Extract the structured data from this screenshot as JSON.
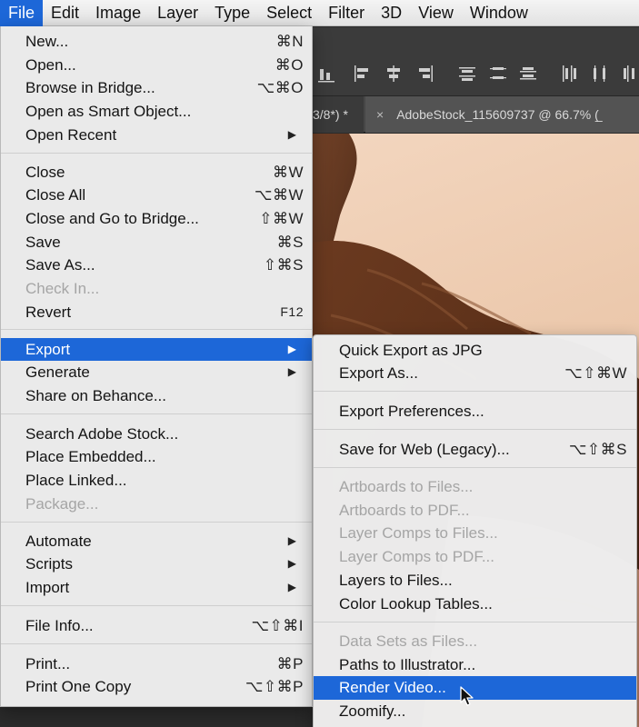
{
  "menubar": {
    "items": [
      "File",
      "Edit",
      "Image",
      "Layer",
      "Type",
      "Select",
      "Filter",
      "3D",
      "View",
      "Window"
    ]
  },
  "tabs": {
    "previous": "3/8*) *",
    "active_close": "×",
    "active": "AdobeStock_115609737 @ 66.7% (̲"
  },
  "file_menu": {
    "new": {
      "label": "New...",
      "shortcut": "⌘N"
    },
    "open": {
      "label": "Open...",
      "shortcut": "⌘O"
    },
    "browse_bridge": {
      "label": "Browse in Bridge...",
      "shortcut": "⌥⌘O"
    },
    "open_smart_object": {
      "label": "Open as Smart Object..."
    },
    "open_recent": {
      "label": "Open Recent",
      "arrow": "▶"
    },
    "close": {
      "label": "Close",
      "shortcut": "⌘W"
    },
    "close_all": {
      "label": "Close All",
      "shortcut": "⌥⌘W"
    },
    "close_go_bridge": {
      "label": "Close and Go to Bridge...",
      "shortcut": "⇧⌘W"
    },
    "save": {
      "label": "Save",
      "shortcut": "⌘S"
    },
    "save_as": {
      "label": "Save As...",
      "shortcut": "⇧⌘S"
    },
    "check_in": {
      "label": "Check In..."
    },
    "revert": {
      "label": "Revert",
      "shortcut": "F12"
    },
    "export": {
      "label": "Export",
      "arrow": "▶"
    },
    "generate": {
      "label": "Generate",
      "arrow": "▶"
    },
    "share_behance": {
      "label": "Share on Behance..."
    },
    "search_stock": {
      "label": "Search Adobe Stock..."
    },
    "place_embedded": {
      "label": "Place Embedded..."
    },
    "place_linked": {
      "label": "Place Linked..."
    },
    "package": {
      "label": "Package..."
    },
    "automate": {
      "label": "Automate",
      "arrow": "▶"
    },
    "scripts": {
      "label": "Scripts",
      "arrow": "▶"
    },
    "import": {
      "label": "Import",
      "arrow": "▶"
    },
    "file_info": {
      "label": "File Info...",
      "shortcut": "⌥⇧⌘I"
    },
    "print": {
      "label": "Print...",
      "shortcut": "⌘P"
    },
    "print_one_copy": {
      "label": "Print One Copy",
      "shortcut": "⌥⇧⌘P"
    }
  },
  "export_menu": {
    "quick_export_jpg": {
      "label": "Quick Export as JPG"
    },
    "export_as": {
      "label": "Export As...",
      "shortcut": "⌥⇧⌘W"
    },
    "export_preferences": {
      "label": "Export Preferences..."
    },
    "save_for_web": {
      "label": "Save for Web (Legacy)...",
      "shortcut": "⌥⇧⌘S"
    },
    "artboards_files": {
      "label": "Artboards to Files..."
    },
    "artboards_pdf": {
      "label": "Artboards to PDF..."
    },
    "layer_comps_files": {
      "label": "Layer Comps to Files..."
    },
    "layer_comps_pdf": {
      "label": "Layer Comps to PDF..."
    },
    "layers_to_files": {
      "label": "Layers to Files..."
    },
    "color_lookup": {
      "label": "Color Lookup Tables..."
    },
    "data_sets": {
      "label": "Data Sets as Files..."
    },
    "paths_illustrator": {
      "label": "Paths to Illustrator..."
    },
    "render_video": {
      "label": "Render Video..."
    },
    "zoomify": {
      "label": "Zoomify..."
    }
  },
  "colors": {
    "highlight": "#1d67d8",
    "menu_bg": "#eeeeee",
    "disabled_text": "#a5a5a5"
  }
}
